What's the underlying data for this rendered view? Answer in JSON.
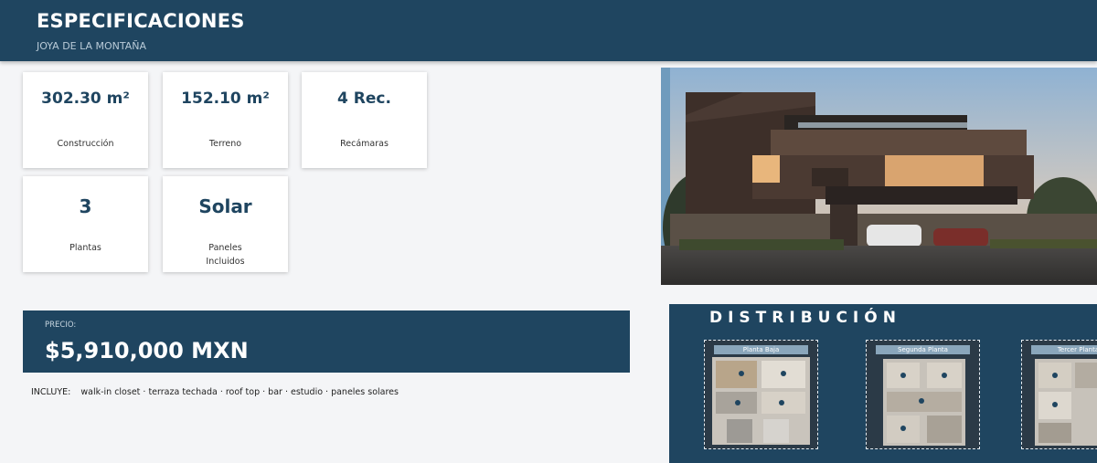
{
  "header": {
    "title": "ESPECIFICACIONES",
    "subtitle": "JOYA DE LA MONTAÑA"
  },
  "specs": [
    {
      "value": "302.30 m²",
      "label": "Construcción"
    },
    {
      "value": "152.10 m²",
      "label": "Terreno"
    },
    {
      "value": "4 Rec.",
      "label": "Recámaras"
    },
    {
      "value": "3",
      "label": "Plantas"
    },
    {
      "value": "Solar",
      "label": "Paneles Incluidos"
    }
  ],
  "price": {
    "label": "PRECIO:",
    "value": "$5,910,000 MXN"
  },
  "includes": {
    "lead": "INCLUYE:",
    "items": "walk-in closet · terraza techada · roof top · bar · estudio · paneles solares"
  },
  "distribution": {
    "title": "DISTRIBUCIÓN",
    "plans": [
      "Planta Baja",
      "Segunda Planta",
      "Tercer Planta"
    ]
  },
  "colors": {
    "primary": "#1f4560",
    "background": "#f4f5f7",
    "card": "#ffffff"
  }
}
